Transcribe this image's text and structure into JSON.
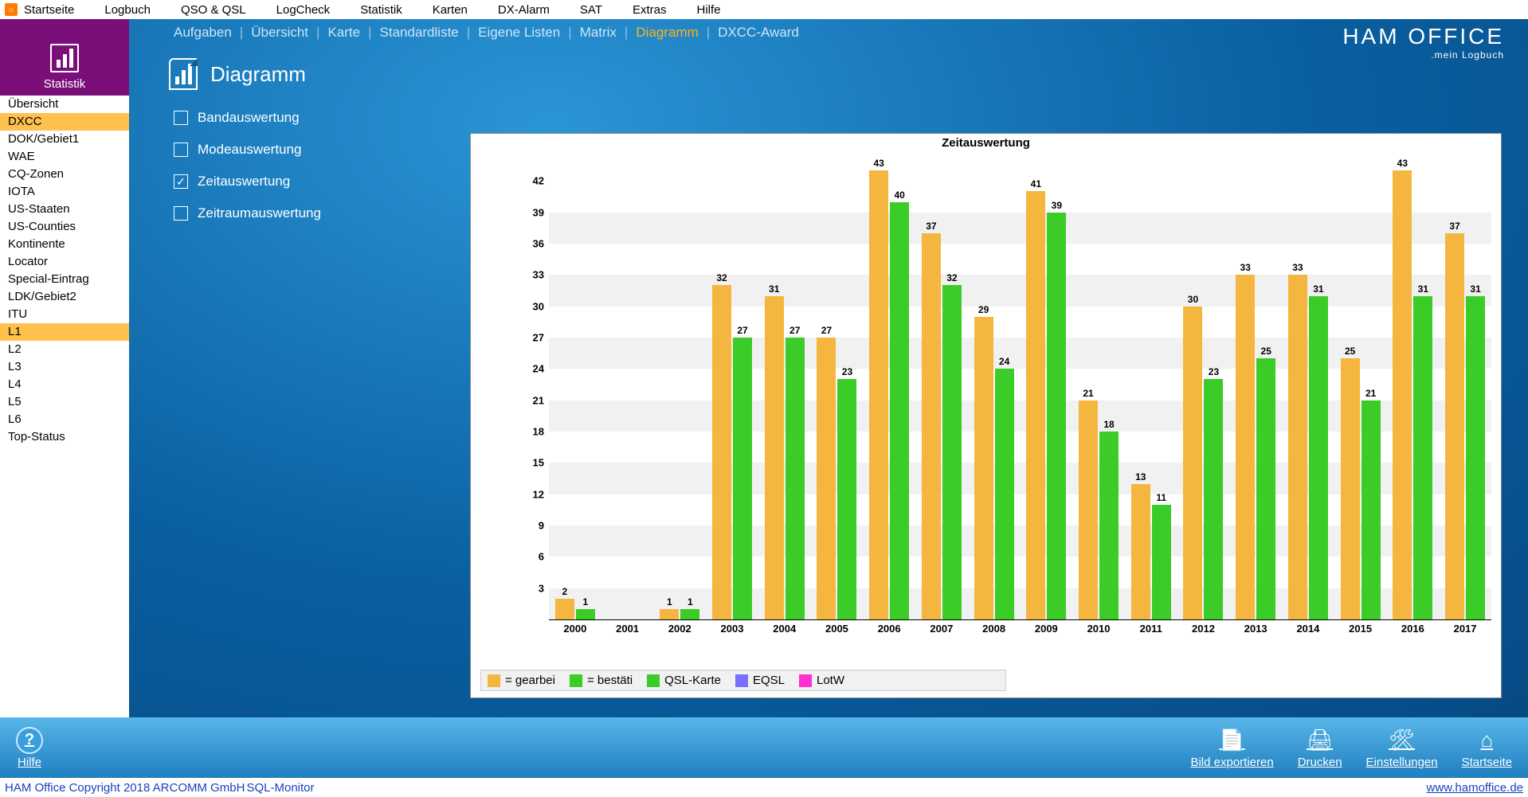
{
  "topmenu": [
    "Startseite",
    "Logbuch",
    "QSO & QSL",
    "LogCheck",
    "Statistik",
    "Karten",
    "DX-Alarm",
    "SAT",
    "Extras",
    "Hilfe"
  ],
  "brand": {
    "line1": "HAM OFFICE",
    "line2": ".mein Logbuch"
  },
  "left": {
    "header": "Statistik",
    "items": [
      "Übersicht",
      "DXCC",
      "DOK/Gebiet1",
      "WAE",
      "CQ-Zonen",
      "IOTA",
      "US-Staaten",
      "US-Counties",
      "Kontinente",
      "Locator",
      "Special-Eintrag",
      "LDK/Gebiet2",
      "ITU",
      "L1",
      "L2",
      "L3",
      "L4",
      "L5",
      "L6",
      "Top-Status"
    ],
    "selected": [
      "DXCC",
      "L1"
    ]
  },
  "subtabs": {
    "items": [
      "Aufgaben",
      "Übersicht",
      "Karte",
      "Standardliste",
      "Eigene Listen",
      "Matrix",
      "Diagramm",
      "DXCC-Award"
    ],
    "active": "Diagramm"
  },
  "page_title": "Diagramm",
  "options": [
    {
      "label": "Bandauswertung",
      "checked": false
    },
    {
      "label": "Modeauswertung",
      "checked": false
    },
    {
      "label": "Zeitauswertung",
      "checked": true
    },
    {
      "label": "Zeitraumauswertung",
      "checked": false
    }
  ],
  "chart_data": {
    "type": "bar",
    "title": "Zeitauswertung",
    "categories": [
      "2000",
      "2001",
      "2002",
      "2003",
      "2004",
      "2005",
      "2006",
      "2007",
      "2008",
      "2009",
      "2010",
      "2011",
      "2012",
      "2013",
      "2014",
      "2015",
      "2016",
      "2017"
    ],
    "series": [
      {
        "name": "= gearbei",
        "color": "#f5b63f",
        "values": [
          2,
          0,
          1,
          32,
          31,
          27,
          43,
          37,
          29,
          41,
          21,
          13,
          30,
          33,
          33,
          25,
          43,
          37
        ]
      },
      {
        "name": "= bestäti",
        "color": "#3bcc28",
        "values": [
          1,
          0,
          1,
          27,
          27,
          23,
          40,
          32,
          24,
          39,
          18,
          11,
          23,
          25,
          31,
          21,
          31,
          31
        ]
      }
    ],
    "extra_legend": [
      {
        "name": "QSL-Karte",
        "color": "#3bcc28"
      },
      {
        "name": "EQSL",
        "color": "#7a6fff"
      },
      {
        "name": "LotW",
        "color": "#ff2fd1"
      }
    ],
    "yticks": [
      3,
      6,
      9,
      12,
      15,
      18,
      21,
      24,
      27,
      30,
      33,
      36,
      39,
      42
    ],
    "ymax": 45
  },
  "bottombar": {
    "help": "Hilfe",
    "actions": [
      {
        "label": "Bild exportieren",
        "icon": "export"
      },
      {
        "label": "Drucken",
        "icon": "print"
      },
      {
        "label": "Einstellungen",
        "icon": "settings"
      },
      {
        "label": "Startseite",
        "icon": "home"
      }
    ]
  },
  "footer": {
    "left": "HAM Office Copyright 2018 ARCOMM GmbH",
    "mid": "SQL-Monitor",
    "right": "www.hamoffice.de"
  }
}
